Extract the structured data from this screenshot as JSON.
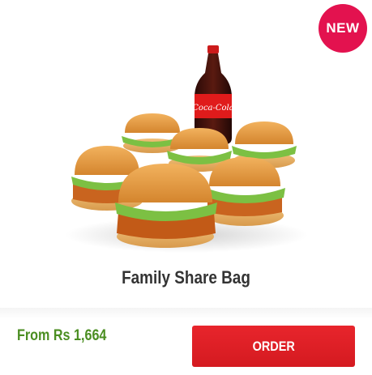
{
  "badge": {
    "label": "NEW"
  },
  "product": {
    "name": "Family Share Bag",
    "price": "From Rs 1,664",
    "image_icon": "burgers-and-cola-bottle-image",
    "bottle_label": "Coca-Cola"
  },
  "actions": {
    "order_label": "ORDER"
  },
  "colors": {
    "badge": "#e3124f",
    "price": "#4b8e22",
    "order_button": "#e0201f",
    "title": "#333333"
  }
}
